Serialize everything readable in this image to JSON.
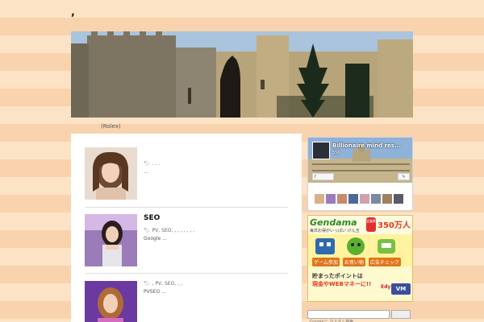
{
  "site": {
    "title": ","
  },
  "tagline": "(Rolex)",
  "posts": [
    {
      "title": "",
      "meta": ". . .",
      "excerpt": "..."
    },
    {
      "title": "SEO",
      "meta": "PV, SEO, , , , , , , ,",
      "excerpt": "Google ..."
    },
    {
      "title": "",
      "meta": ", PV, SEO, , ,",
      "excerpt": "PVSEO ..."
    }
  ],
  "facebook": {
    "page_name": "Billionaire mind res...",
    "likes": "556",
    "like_label": "f",
    "share_label": "✎"
  },
  "ad": {
    "logo": "Gendama",
    "sub": "毎日お得がいっぱい げん玉",
    "badge": "会員数",
    "member_count": "350万人",
    "labels": [
      "ゲーム参加",
      "お買い物",
      "広告チェック"
    ],
    "line1": "貯まったポイントは",
    "line2": "現金やWEBマネーに!!",
    "edy": "Edy",
    "vm": "VM"
  },
  "search": {
    "placeholder": "Google™ カスタム検索"
  },
  "colors": {
    "bg_stripe_a": "#fce3c6",
    "bg_stripe_b": "#f9d3ad",
    "ad_green": "#2b8a22",
    "ad_red": "#e8351e"
  }
}
